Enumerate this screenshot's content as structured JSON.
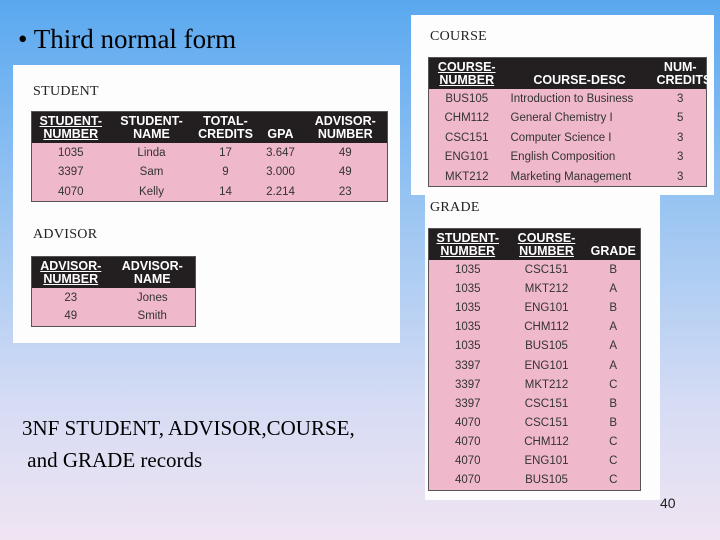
{
  "slide": {
    "title": "• Third normal form",
    "caption_line1": "3NF STUDENT, ADVISOR,COURSE,",
    "caption_line2": " and GRADE records",
    "page_number": "40"
  },
  "tables": {
    "student": {
      "label": "STUDENT",
      "headers": [
        {
          "l1": "STUDENT-",
          "l2": "NUMBER",
          "key": true
        },
        {
          "l1": "STUDENT-",
          "l2": "NAME",
          "key": false
        },
        {
          "l1": "TOTAL-",
          "l2": "CREDITS",
          "key": false
        },
        {
          "l1": "",
          "l2": "GPA",
          "key": false
        },
        {
          "l1": "ADVISOR-",
          "l2": "NUMBER",
          "key": false
        }
      ],
      "rows": [
        [
          "1035",
          "Linda",
          "17",
          "3.647",
          "49"
        ],
        [
          "3397",
          "Sam",
          "9",
          "3.000",
          "49"
        ],
        [
          "4070",
          "Kelly",
          "14",
          "2.214",
          "23"
        ]
      ]
    },
    "advisor": {
      "label": "ADVISOR",
      "headers": [
        {
          "l1": "ADVISOR-",
          "l2": "NUMBER",
          "key": true
        },
        {
          "l1": "ADVISOR-",
          "l2": "NAME",
          "key": false
        }
      ],
      "rows": [
        [
          "23",
          "Jones"
        ],
        [
          "49",
          "Smith"
        ]
      ]
    },
    "course": {
      "label": "COURSE",
      "headers": [
        {
          "l1": "COURSE-",
          "l2": "NUMBER",
          "key": true
        },
        {
          "l1": "",
          "l2": "COURSE-DESC",
          "key": false
        },
        {
          "l1": "NUM-",
          "l2": "CREDITS",
          "key": false
        }
      ],
      "rows": [
        [
          "BUS105",
          "Introduction to Business",
          "3"
        ],
        [
          "CHM112",
          "General Chemistry I",
          "5"
        ],
        [
          "CSC151",
          "Computer Science I",
          "3"
        ],
        [
          "ENG101",
          "English Composition",
          "3"
        ],
        [
          "MKT212",
          "Marketing Management",
          "3"
        ]
      ]
    },
    "grade": {
      "label": "GRADE",
      "headers": [
        {
          "l1": "STUDENT-",
          "l2": "NUMBER",
          "key": true
        },
        {
          "l1": "COURSE-",
          "l2": "NUMBER",
          "key": true
        },
        {
          "l1": "",
          "l2": "GRADE",
          "key": false
        }
      ],
      "rows": [
        [
          "1035",
          "CSC151",
          "B"
        ],
        [
          "1035",
          "MKT212",
          "A"
        ],
        [
          "1035",
          "ENG101",
          "B"
        ],
        [
          "1035",
          "CHM112",
          "A"
        ],
        [
          "1035",
          "BUS105",
          "A"
        ],
        [
          "3397",
          "ENG101",
          "A"
        ],
        [
          "3397",
          "MKT212",
          "C"
        ],
        [
          "3397",
          "CSC151",
          "B"
        ],
        [
          "4070",
          "CSC151",
          "B"
        ],
        [
          "4070",
          "CHM112",
          "C"
        ],
        [
          "4070",
          "ENG101",
          "C"
        ],
        [
          "4070",
          "BUS105",
          "C"
        ]
      ]
    }
  }
}
